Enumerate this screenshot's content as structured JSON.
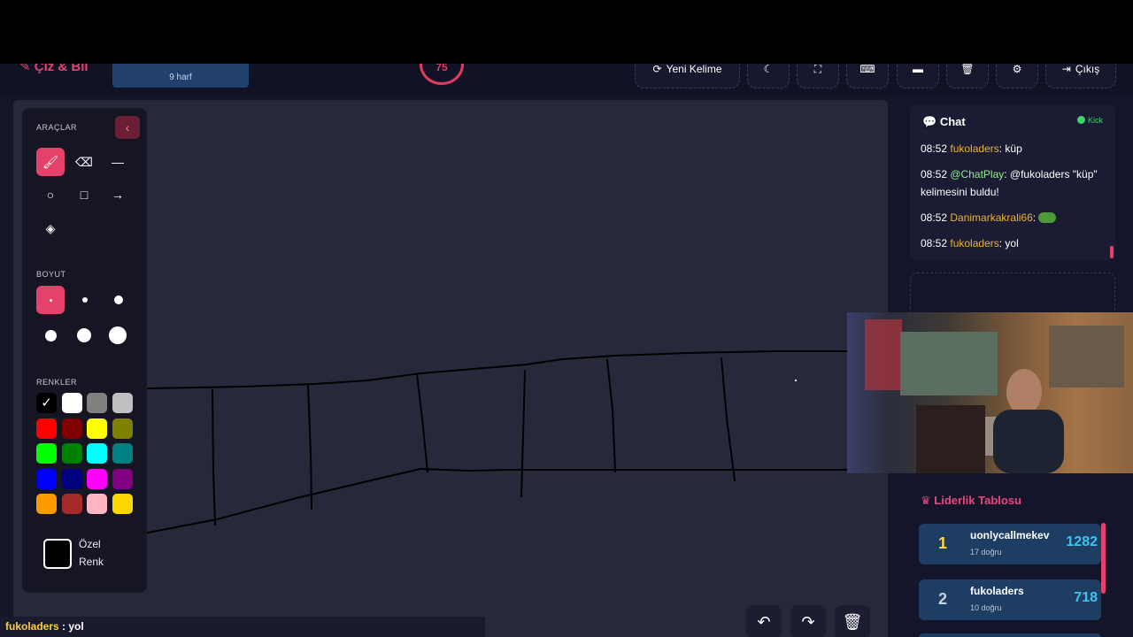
{
  "header": {
    "logo": "Çiz & Bil",
    "word_hint": "9 harf",
    "timer": "75",
    "buttons": {
      "new_word": "Yeni Kelime",
      "exit": "Çıkış"
    }
  },
  "tools": {
    "tools_label": "ARAÇLAR",
    "size_label": "BOYUT",
    "colors_label": "RENKLER",
    "custom_color": "Özel Renk",
    "colors": [
      "#000000",
      "#ffffff",
      "#808080",
      "#c0c0c0",
      "#ff0000",
      "#800000",
      "#ffff00",
      "#808000",
      "#00ff00",
      "#008000",
      "#00ffff",
      "#008080",
      "#0000ff",
      "#000080",
      "#ff00ff",
      "#800080",
      "#ff9900",
      "#a52a2a",
      "#ffb6c1",
      "#ffd700"
    ]
  },
  "chat": {
    "title": "Chat",
    "platform": "Kick",
    "messages": [
      {
        "time": "08:52",
        "user": "fukoladers",
        "text": ": küp"
      },
      {
        "time": "08:52",
        "user": "@ChatPlay",
        "text": ": @fukoladers \"küp\" kelimesini buldu!"
      },
      {
        "time": "08:52",
        "user": "Danimarkakrali66",
        "text": ":"
      },
      {
        "time": "08:52",
        "user": "fukoladers",
        "text": ": yol"
      }
    ]
  },
  "leaderboard": {
    "title": "Liderlik Tablosu",
    "rows": [
      {
        "rank": "1",
        "name": "uonlycallmekev",
        "sub": "17 doğru",
        "score": "1282"
      },
      {
        "rank": "2",
        "name": "fukoladers",
        "sub": "10 doğru",
        "score": "718"
      }
    ]
  },
  "status_bar": {
    "user": "fukoladers",
    "text": " : yol"
  }
}
